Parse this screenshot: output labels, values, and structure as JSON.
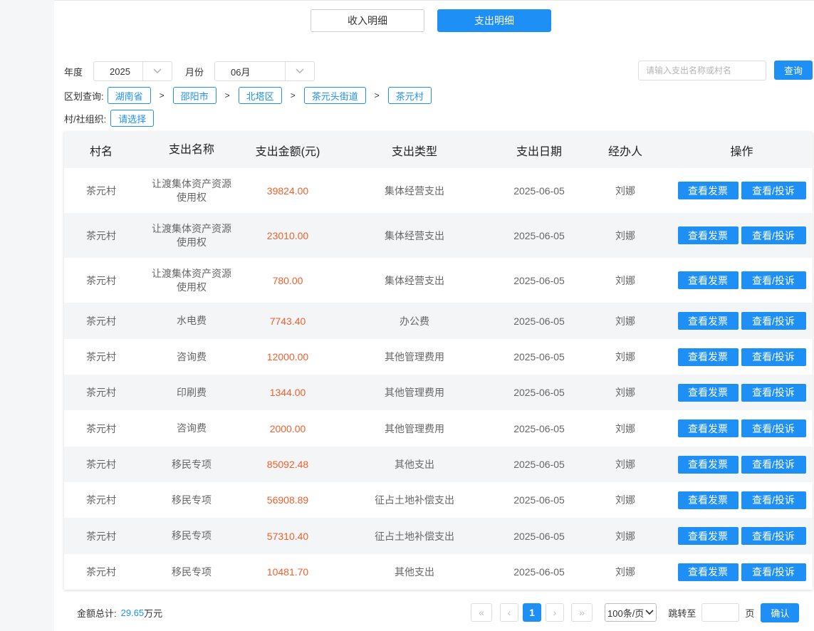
{
  "tabs": {
    "income": "收入明细",
    "expense": "支出明细"
  },
  "filters": {
    "year_label": "年度",
    "year_value": "2025",
    "month_label": "月份",
    "month_value": "06月",
    "region_label": "区划查询:",
    "regions": [
      "湖南省",
      "邵阳市",
      "北塔区",
      "茶元头街道",
      "茶元村"
    ],
    "separator": ">",
    "org_label": "村/社组织:",
    "org_value": "请选择"
  },
  "search": {
    "placeholder": "请输入支出名称或村名",
    "button": "查询"
  },
  "table": {
    "headers": [
      "村名",
      "支出名称",
      "支出金额(元)",
      "支出类型",
      "支出日期",
      "经办人",
      "操作"
    ],
    "action_labels": [
      "查看发票",
      "查看/投诉"
    ],
    "rows": [
      {
        "village": "茶元村",
        "name_lines": [
          "让渡集体资产资源",
          "使用权"
        ],
        "amount": "39824.00",
        "type": "集体经营支出",
        "date": "2025-06-05",
        "handler": "刘娜"
      },
      {
        "village": "茶元村",
        "name_lines": [
          "让渡集体资产资源",
          "使用权"
        ],
        "amount": "23010.00",
        "type": "集体经营支出",
        "date": "2025-06-05",
        "handler": "刘娜"
      },
      {
        "village": "茶元村",
        "name_lines": [
          "让渡集体资产资源",
          "使用权"
        ],
        "amount": "780.00",
        "type": "集体经营支出",
        "date": "2025-06-05",
        "handler": "刘娜"
      },
      {
        "village": "茶元村",
        "name_lines": [
          "水电费"
        ],
        "amount": "7743.40",
        "type": "办公费",
        "date": "2025-06-05",
        "handler": "刘娜"
      },
      {
        "village": "茶元村",
        "name_lines": [
          "咨询费"
        ],
        "amount": "12000.00",
        "type": "其他管理费用",
        "date": "2025-06-05",
        "handler": "刘娜"
      },
      {
        "village": "茶元村",
        "name_lines": [
          "印刷费"
        ],
        "amount": "1344.00",
        "type": "其他管理费用",
        "date": "2025-06-05",
        "handler": "刘娜"
      },
      {
        "village": "茶元村",
        "name_lines": [
          "咨询费"
        ],
        "amount": "2000.00",
        "type": "其他管理费用",
        "date": "2025-06-05",
        "handler": "刘娜"
      },
      {
        "village": "茶元村",
        "name_lines": [
          "移民专项"
        ],
        "amount": "85092.48",
        "type": "其他支出",
        "date": "2025-06-05",
        "handler": "刘娜"
      },
      {
        "village": "茶元村",
        "name_lines": [
          "移民专项"
        ],
        "amount": "56908.89",
        "type": "征占土地补偿支出",
        "date": "2025-06-05",
        "handler": "刘娜"
      },
      {
        "village": "茶元村",
        "name_lines": [
          "移民专项"
        ],
        "amount": "57310.40",
        "type": "征占土地补偿支出",
        "date": "2025-06-05",
        "handler": "刘娜"
      },
      {
        "village": "茶元村",
        "name_lines": [
          "移民专项"
        ],
        "amount": "10481.70",
        "type": "其他支出",
        "date": "2025-06-05",
        "handler": "刘娜"
      }
    ]
  },
  "footer": {
    "total_label": "金额总计:",
    "total_value": "29.65",
    "total_unit": "万元"
  },
  "pager": {
    "first": "«",
    "prev": "‹",
    "current": "1",
    "next": "›",
    "last": "»",
    "page_size": "100条/页",
    "jump_label": "跳转至",
    "page_unit": "页",
    "confirm": "确认"
  },
  "colors": {
    "accent": "#1e90f5",
    "amount": "#f0602c",
    "stripe": "#f4f5f7"
  },
  "icons": {
    "dropdown": "chevron-down-icon"
  }
}
